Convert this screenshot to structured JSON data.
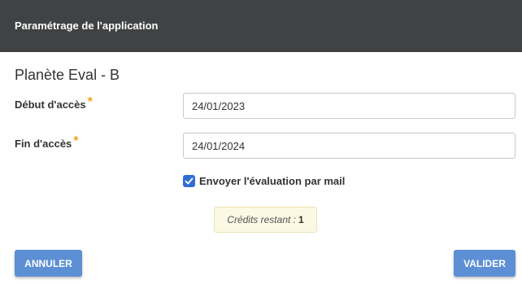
{
  "header": {
    "title": "Paramétrage de l'application"
  },
  "app": {
    "name": "Planète Eval - B"
  },
  "form": {
    "start": {
      "label": "Début d'accès",
      "required_mark": "*",
      "value": "24/01/2023"
    },
    "end": {
      "label": "Fin d'accès",
      "required_mark": "*",
      "value": "24/01/2024"
    },
    "send_mail": {
      "label": "Envoyer l'évaluation par mail",
      "checked": true
    }
  },
  "credits": {
    "label": "Crédits restant :",
    "value": "1"
  },
  "buttons": {
    "cancel": "ANNULER",
    "validate": "VALIDER"
  },
  "colors": {
    "header_bg": "#404243",
    "accent": "#5d8fd4",
    "required": "#f0a020",
    "checkbox": "#2f6fd2",
    "credits_bg": "#fbf8e3"
  }
}
